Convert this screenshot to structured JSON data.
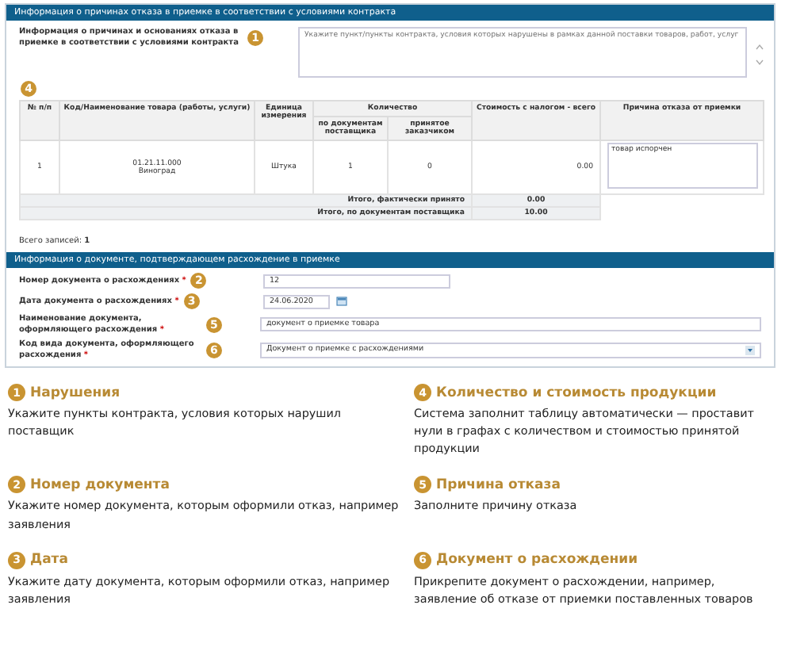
{
  "reasons_section": {
    "title": "Информация о причинах отказа в приемке в соответствии с условиями контракта",
    "label": "Информация о причинах и основаниях отказа в приемке в соответствии с условиями контракта",
    "marker": "1",
    "textarea": {
      "placeholder": "Укажите пункт/пункты контракта, условия которых нарушены в рамках данной поставки товаров, работ, услуг"
    }
  },
  "table": {
    "marker": "4",
    "columns": {
      "number": "№ п/п",
      "item": "Код/Наименование товара (работы, услуги)",
      "unit": "Единица измерения",
      "quantity": "Количество",
      "qty_supplier": "по документам поставщика",
      "qty_accepted": "принятое заказчиком",
      "cost": "Стоимость с налогом - всего",
      "reason": "Причина отказа от приемки"
    },
    "rows": [
      {
        "number": "1",
        "code": "01.21.11.000",
        "name": "Виноград",
        "unit": "Штука",
        "qty_supplier": "1",
        "qty_accepted": "0",
        "cost": "0.00",
        "reason": "товар испорчен"
      }
    ],
    "totals": [
      {
        "label": "Итого, фактически принято",
        "value": "0.00"
      },
      {
        "label": "Итого, по документам поставщика",
        "value": "10.00"
      }
    ],
    "count_label": "Всего записей:",
    "count": "1"
  },
  "document_section": {
    "title": "Информация о документе, подтверждающем расхождение в приемке",
    "fields": [
      {
        "kind": "text",
        "label": "Номер документа о расхождениях",
        "required_mark": "*",
        "marker": "2",
        "value": "12"
      },
      {
        "kind": "date",
        "label": "Дата документа о расхождениях",
        "required_mark": "*",
        "marker": "3",
        "value": "24.06.2020"
      },
      {
        "kind": "wide",
        "label": "Наименование документа, оформляющего расхождения",
        "required_mark": "*",
        "marker": "5",
        "value": "документ о приемке товара"
      },
      {
        "kind": "select",
        "label": "Код вида документа, оформляющего расхождения",
        "required_mark": "*",
        "marker": "6",
        "value": "Документ о приемке с расхождениями"
      }
    ]
  },
  "notes": [
    {
      "marker": "1",
      "title": "Нарушения",
      "text": "Укажите пункты контракта, условия которых нарушил поставщик"
    },
    {
      "marker": "4",
      "title": "Количество и стоимость продукции",
      "text": "Система заполнит таблицу автоматически — проставит нули в графах с количеством и стоимостью принятой продукции"
    },
    {
      "marker": "2",
      "title": "Номер документа",
      "text": "Укажите номер документа, которым оформили отказ, например заявления"
    },
    {
      "marker": "5",
      "title": "Причина отказа",
      "text": "Заполните причину отказа"
    },
    {
      "marker": "3",
      "title": "Дата",
      "text": "Укажите дату документа, которым оформили отказ, например заявления"
    },
    {
      "marker": "6",
      "title": "Документ о расхождении",
      "text": "Прикрепите документ о расхождении, например, заявление об отказе от приемки поставленных товаров"
    }
  ]
}
